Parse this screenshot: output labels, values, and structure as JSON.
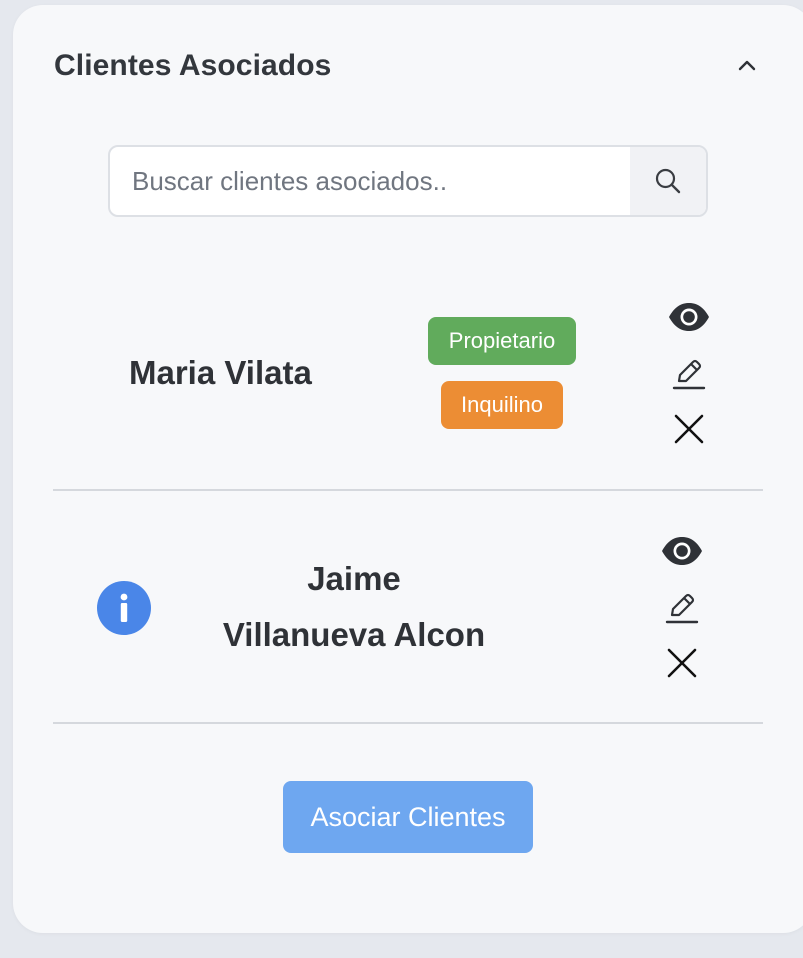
{
  "panel": {
    "title": "Clientes Asociados",
    "collapse_icon": "chevron-up-icon"
  },
  "search": {
    "placeholder": "Buscar clientes asociados..",
    "value": "",
    "icon": "search-icon"
  },
  "clients": [
    {
      "name": "Maria Vilata",
      "badges": [
        {
          "label": "Propietario",
          "color": "#61ab5c"
        },
        {
          "label": "Inquilino",
          "color": "#ec8d34"
        }
      ],
      "actions": [
        "eye-icon",
        "edit-icon",
        "close-icon"
      ]
    },
    {
      "name_line1": "Jaime",
      "name_line2": "Villanueva Alcon",
      "info_icon": "info-icon",
      "actions": [
        "eye-icon",
        "edit-icon",
        "close-icon"
      ]
    }
  ],
  "footer": {
    "button_label": "Asociar Clientes"
  },
  "colors": {
    "background": "#e5e8ee",
    "card": "#f7f8fa",
    "primary_button": "#6ea7f0",
    "info": "#4a86e8"
  }
}
